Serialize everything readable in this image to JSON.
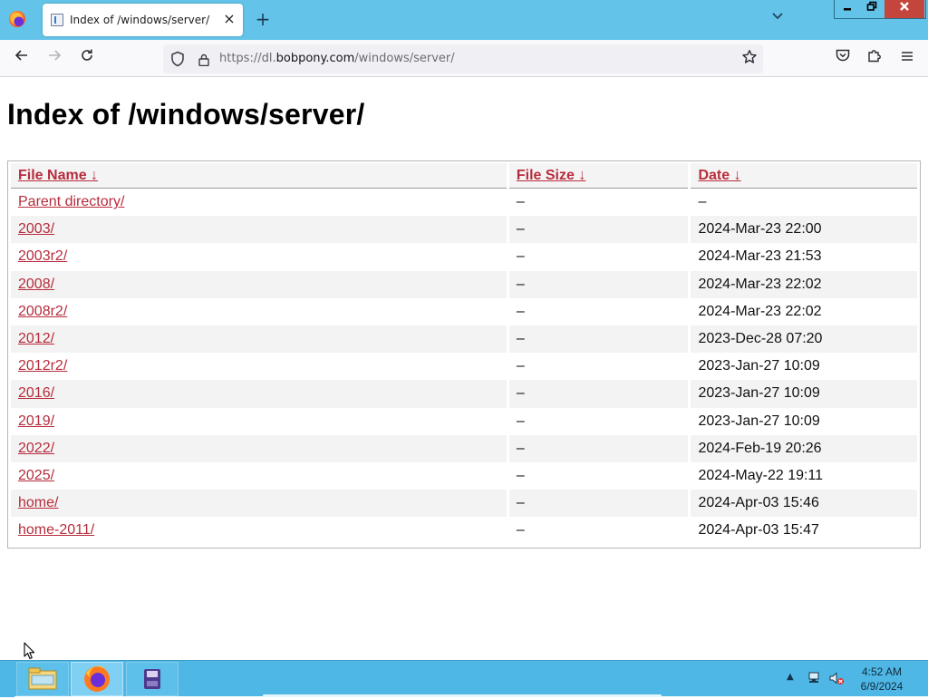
{
  "browser": {
    "tab_title": "Index of /windows/server/",
    "url_prefix": "https://dl.",
    "url_host": "bobpony.com",
    "url_path": "/windows/server/",
    "new_tab_symbol": "+",
    "close_tab_symbol": "×"
  },
  "page": {
    "heading": "Index of /windows/server/",
    "columns": [
      {
        "label": "File Name",
        "sort_arrow": "↓"
      },
      {
        "label": "File Size",
        "sort_arrow": "↓"
      },
      {
        "label": "Date",
        "sort_arrow": "↓"
      }
    ],
    "rows": [
      {
        "name": "Parent directory/",
        "size": "–",
        "date": "–"
      },
      {
        "name": "2003/",
        "size": "–",
        "date": "2024-Mar-23 22:00"
      },
      {
        "name": "2003r2/",
        "size": "–",
        "date": "2024-Mar-23 21:53"
      },
      {
        "name": "2008/",
        "size": "–",
        "date": "2024-Mar-23 22:02"
      },
      {
        "name": "2008r2/",
        "size": "–",
        "date": "2024-Mar-23 22:02"
      },
      {
        "name": "2012/",
        "size": "–",
        "date": "2023-Dec-28 07:20"
      },
      {
        "name": "2012r2/",
        "size": "–",
        "date": "2023-Jan-27 10:09"
      },
      {
        "name": "2016/",
        "size": "–",
        "date": "2023-Jan-27 10:09"
      },
      {
        "name": "2019/",
        "size": "–",
        "date": "2023-Jan-27 10:09"
      },
      {
        "name": "2022/",
        "size": "–",
        "date": "2024-Feb-19 20:26"
      },
      {
        "name": "2025/",
        "size": "–",
        "date": "2024-May-22 19:11"
      },
      {
        "name": "home/",
        "size": "–",
        "date": "2024-Apr-03 15:46"
      },
      {
        "name": "home-2011/",
        "size": "–",
        "date": "2024-Apr-03 15:47"
      }
    ]
  },
  "taskbar": {
    "time": "4:52 AM",
    "date": "6/9/2024",
    "apps": [
      "file-explorer-icon",
      "firefox-icon",
      "disk-app-icon"
    ]
  },
  "colors": {
    "titlebar": "#63c3e8",
    "link": "#b72c3c",
    "taskbar": "#4fb7e5",
    "close_button": "#c4453c"
  }
}
